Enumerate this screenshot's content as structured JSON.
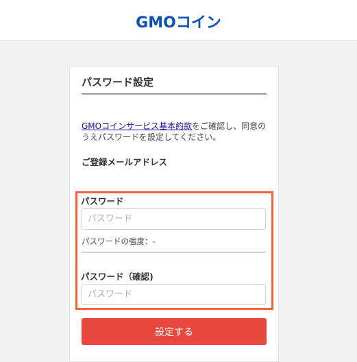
{
  "header": {
    "logo_text": "GMOコイン"
  },
  "card": {
    "title": "パスワード設定",
    "terms": {
      "link_text": "GMOコインサービス基本約款",
      "text_after_link": "をご確認し、同意のうえパスワードを設定してください。"
    },
    "email_label": "ご登録メールアドレス",
    "password": {
      "label": "パスワード",
      "placeholder": "パスワード",
      "value": "",
      "strength_text": "パスワードの強度：-"
    },
    "password_confirm": {
      "label": "パスワード（確認)",
      "placeholder": "パスワード",
      "value": ""
    },
    "submit_label": "設定する"
  },
  "colors": {
    "brand_blue": "#0a4fb2",
    "submit_red": "#e8473e",
    "highlight_orange": "#f0643c"
  }
}
